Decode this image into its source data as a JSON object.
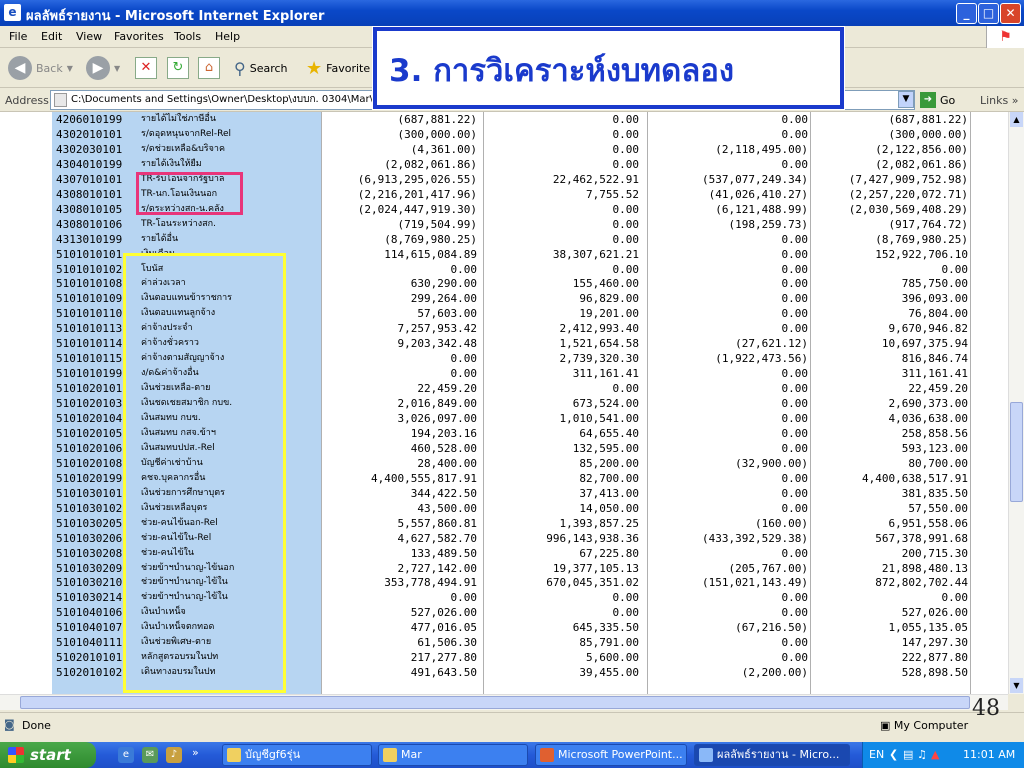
{
  "window": {
    "title": "ผลลัพธ์รายงาน - Microsoft Internet Explorer",
    "minimize": "_",
    "maximize": "□",
    "close": "✕"
  },
  "menu": [
    "File",
    "Edit",
    "View",
    "Favorites",
    "Tools",
    "Help"
  ],
  "toolbar": {
    "back": "Back",
    "search": "Search",
    "favorites": "Favorite"
  },
  "address": {
    "label": "Address",
    "value": "C:\\Documents and Settings\\Owner\\Desktop\\งบบก. 0304\\Mar\\0",
    "go": "Go",
    "links": "Links"
  },
  "banner": "3. การวิเคราะห์งบทดลอง",
  "slide_number": "48",
  "rows": [
    [
      "4206010199",
      "รายได้ไม่ใช่ภาษีอื่น",
      "(687,881.22)",
      "0.00",
      "0.00",
      "(687,881.22)"
    ],
    [
      "4302010101",
      "ร/ดอุดหนุนจากRel-Rel",
      "(300,000.00)",
      "0.00",
      "0.00",
      "(300,000.00)"
    ],
    [
      "4302030101",
      "ร/ดช่วยเหลือ&บริจาค",
      "(4,361.00)",
      "0.00",
      "(2,118,495.00)",
      "(2,122,856.00)"
    ],
    [
      "4304010199",
      "รายได้เงินให้ยืม",
      "(2,082,061.86)",
      "0.00",
      "0.00",
      "(2,082,061.86)"
    ],
    [
      "4307010101",
      "TR-รับโอนจากรัฐบาล",
      "(6,913,295,026.55)",
      "22,462,522.91",
      "(537,077,249.34)",
      "(7,427,909,752.98)"
    ],
    [
      "4308010101",
      "TR-นก.โอนเงินนอก",
      "(2,216,201,417.96)",
      "7,755.52",
      "(41,026,410.27)",
      "(2,257,220,072.71)"
    ],
    [
      "4308010105",
      "ร/ดระหว่างสก-น.คลัง",
      "(2,024,447,919.30)",
      "0.00",
      "(6,121,488.99)",
      "(2,030,569,408.29)"
    ],
    [
      "4308010106",
      "TR-โอนระหว่างสก.",
      "(719,504.99)",
      "0.00",
      "(198,259.73)",
      "(917,764.72)"
    ],
    [
      "4313010199",
      "รายได้อื่น",
      "(8,769,980.25)",
      "0.00",
      "0.00",
      "(8,769,980.25)"
    ],
    [
      "5101010101",
      "เงินเดือน",
      "114,615,084.89",
      "38,307,621.21",
      "0.00",
      "152,922,706.10"
    ],
    [
      "5101010102",
      "โบนัส",
      "0.00",
      "0.00",
      "0.00",
      "0.00"
    ],
    [
      "5101010108",
      "ค่าล่วงเวลา",
      "630,290.00",
      "155,460.00",
      "0.00",
      "785,750.00"
    ],
    [
      "5101010109",
      "เงินตอบแทนข้าราชการ",
      "299,264.00",
      "96,829.00",
      "0.00",
      "396,093.00"
    ],
    [
      "5101010110",
      "เงินตอบแทนลูกจ้าง",
      "57,603.00",
      "19,201.00",
      "0.00",
      "76,804.00"
    ],
    [
      "5101010113",
      "ค่าจ้างประจำ",
      "7,257,953.42",
      "2,412,993.40",
      "0.00",
      "9,670,946.82"
    ],
    [
      "5101010114",
      "ค่าจ้างชั่วคราว",
      "9,203,342.48",
      "1,521,654.58",
      "(27,621.12)",
      "10,697,375.94"
    ],
    [
      "5101010115",
      "ค่าจ้างตามสัญญาจ้าง",
      "0.00",
      "2,739,320.30",
      "(1,922,473.56)",
      "816,846.74"
    ],
    [
      "5101010199",
      "ง/ด&ค่าจ้างอื่น",
      "0.00",
      "311,161.41",
      "0.00",
      "311,161.41"
    ],
    [
      "5101020101",
      "เงินช่วยเหลือ-ตาย",
      "22,459.20",
      "0.00",
      "0.00",
      "22,459.20"
    ],
    [
      "5101020103",
      "เงินชดเชยสมาชิก กบข.",
      "2,016,849.00",
      "673,524.00",
      "0.00",
      "2,690,373.00"
    ],
    [
      "5101020104",
      "เงินสมทบ กบข.",
      "3,026,097.00",
      "1,010,541.00",
      "0.00",
      "4,036,638.00"
    ],
    [
      "5101020105",
      "เงินสมทบ กสจ.ข้าฯ",
      "194,203.16",
      "64,655.40",
      "0.00",
      "258,858.56"
    ],
    [
      "5101020106",
      "เงินสมทบปปส.-Rel",
      "460,528.00",
      "132,595.00",
      "0.00",
      "593,123.00"
    ],
    [
      "5101020108",
      "บัญชีค่าเช่าบ้าน",
      "28,400.00",
      "85,200.00",
      "(32,900.00)",
      "80,700.00"
    ],
    [
      "5101020199",
      "คชจ.บุคลากรอื่น",
      "4,400,555,817.91",
      "82,700.00",
      "0.00",
      "4,400,638,517.91"
    ],
    [
      "5101030101",
      "เงินช่วยการศึกษาบุตร",
      "344,422.50",
      "37,413.00",
      "0.00",
      "381,835.50"
    ],
    [
      "5101030102",
      "เงินช่วยเหลือบุตร",
      "43,500.00",
      "14,050.00",
      "0.00",
      "57,550.00"
    ],
    [
      "5101030205",
      "ช่วย-คนไข้นอก-Rel",
      "5,557,860.81",
      "1,393,857.25",
      "(160.00)",
      "6,951,558.06"
    ],
    [
      "5101030206",
      "ช่วย-คนไข้ใน-Rel",
      "4,627,582.70",
      "996,143,938.36",
      "(433,392,529.38)",
      "567,378,991.68"
    ],
    [
      "5101030208",
      "ช่วย-คนไข้ใน",
      "133,489.50",
      "67,225.80",
      "0.00",
      "200,715.30"
    ],
    [
      "5101030209",
      "ช่วยข้าฯบำนาญ-ไข้นอก",
      "2,727,142.00",
      "19,377,105.13",
      "(205,767.00)",
      "21,898,480.13"
    ],
    [
      "5101030210",
      "ช่วยข้าฯบำนาญ-ไข้ใน",
      "353,778,494.91",
      "670,045,351.02",
      "(151,021,143.49)",
      "872,802,702.44"
    ],
    [
      "5101030214",
      "ช่วยข้าฯบำนาญ-ไข้ใน",
      "0.00",
      "0.00",
      "0.00",
      "0.00"
    ],
    [
      "5101040106",
      "เงินบำเหน็จ",
      "527,026.00",
      "0.00",
      "0.00",
      "527,026.00"
    ],
    [
      "5101040107",
      "เงินบำเหน็จตกทอด",
      "477,016.05",
      "645,335.50",
      "(67,216.50)",
      "1,055,135.05"
    ],
    [
      "5101040111",
      "เงินช่วยพิเศษ-ตาย",
      "61,506.30",
      "85,791.00",
      "0.00",
      "147,297.30"
    ],
    [
      "5102010101",
      "หลักสูตรอบรมในปท",
      "217,277.80",
      "5,600.00",
      "0.00",
      "222,877.80"
    ],
    [
      "5102010102",
      "เดินทางอบรมในปท",
      "491,643.50",
      "39,455.00",
      "(2,200.00)",
      "528,898.50"
    ]
  ],
  "status": {
    "text": "Done",
    "zone": "My Computer"
  },
  "taskbar": {
    "start": "start",
    "tasks": [
      "บัญชีgf6รุ่น",
      "Mar",
      "Microsoft PowerPoint...",
      "ผลลัพธ์รายงาน - Micro..."
    ],
    "lang": "EN",
    "clock": "11:01 AM"
  }
}
